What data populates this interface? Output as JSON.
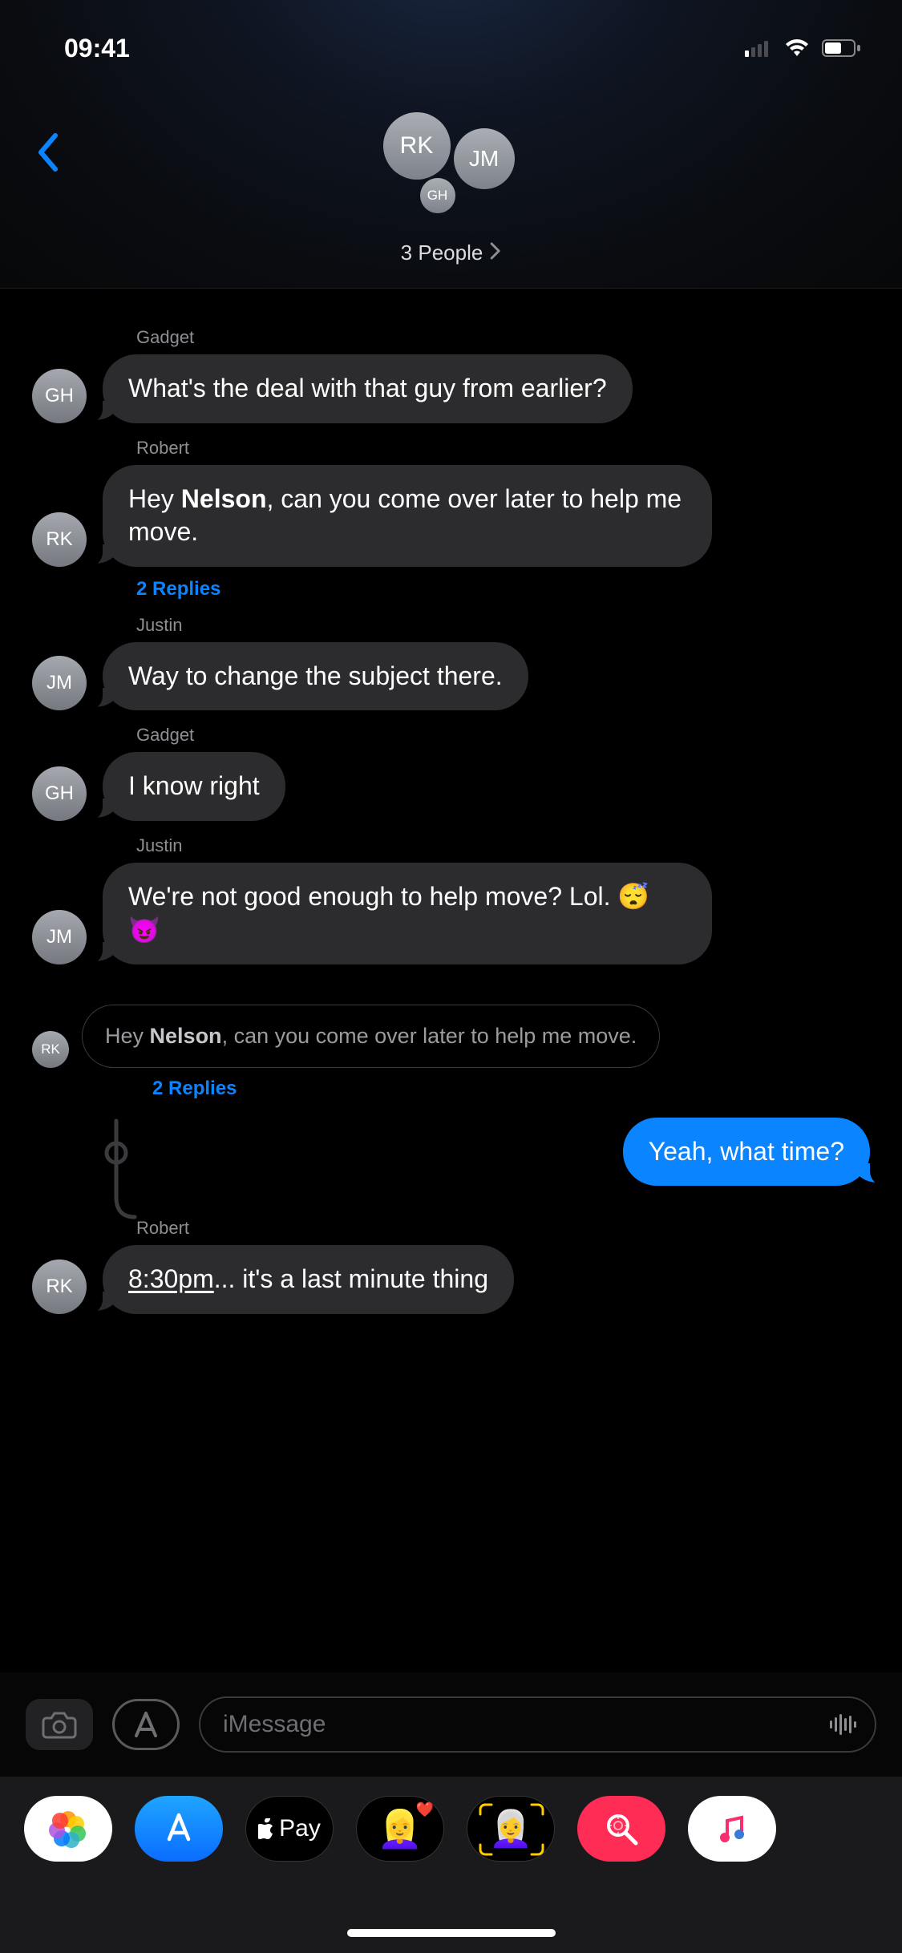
{
  "status": {
    "time": "09:41"
  },
  "header": {
    "avatars": {
      "rk": "RK",
      "jm": "JM",
      "gh": "GH"
    },
    "title": "3 People"
  },
  "messages": [
    {
      "sender": "Gadget",
      "avatar": "GH",
      "text": "What's the deal with that guy from earlier?"
    },
    {
      "sender": "Robert",
      "avatar": "RK",
      "prefix": "Hey ",
      "bold": "Nelson",
      "suffix": ", can you come over later to help me move.",
      "replies": "2 Replies"
    },
    {
      "sender": "Justin",
      "avatar": "JM",
      "text": "Way to change the subject there."
    },
    {
      "sender": "Gadget",
      "avatar": "GH",
      "text": "I know right"
    },
    {
      "sender": "Justin",
      "avatar": "JM",
      "text": "We're not good enough to help move? Lol. 😴 😈"
    }
  ],
  "quoted": {
    "avatar": "RK",
    "prefix": "Hey ",
    "bold": "Nelson",
    "suffix": ", can you come over later to help me move.",
    "replies": "2 Replies"
  },
  "outgoing": {
    "text": "Yeah, what time?"
  },
  "last": {
    "sender": "Robert",
    "avatar": "RK",
    "underlined": "8:30pm",
    "rest": "... it's a last minute thing"
  },
  "compose": {
    "placeholder": "iMessage"
  },
  "drawer": {
    "pay_label": "Pay"
  }
}
